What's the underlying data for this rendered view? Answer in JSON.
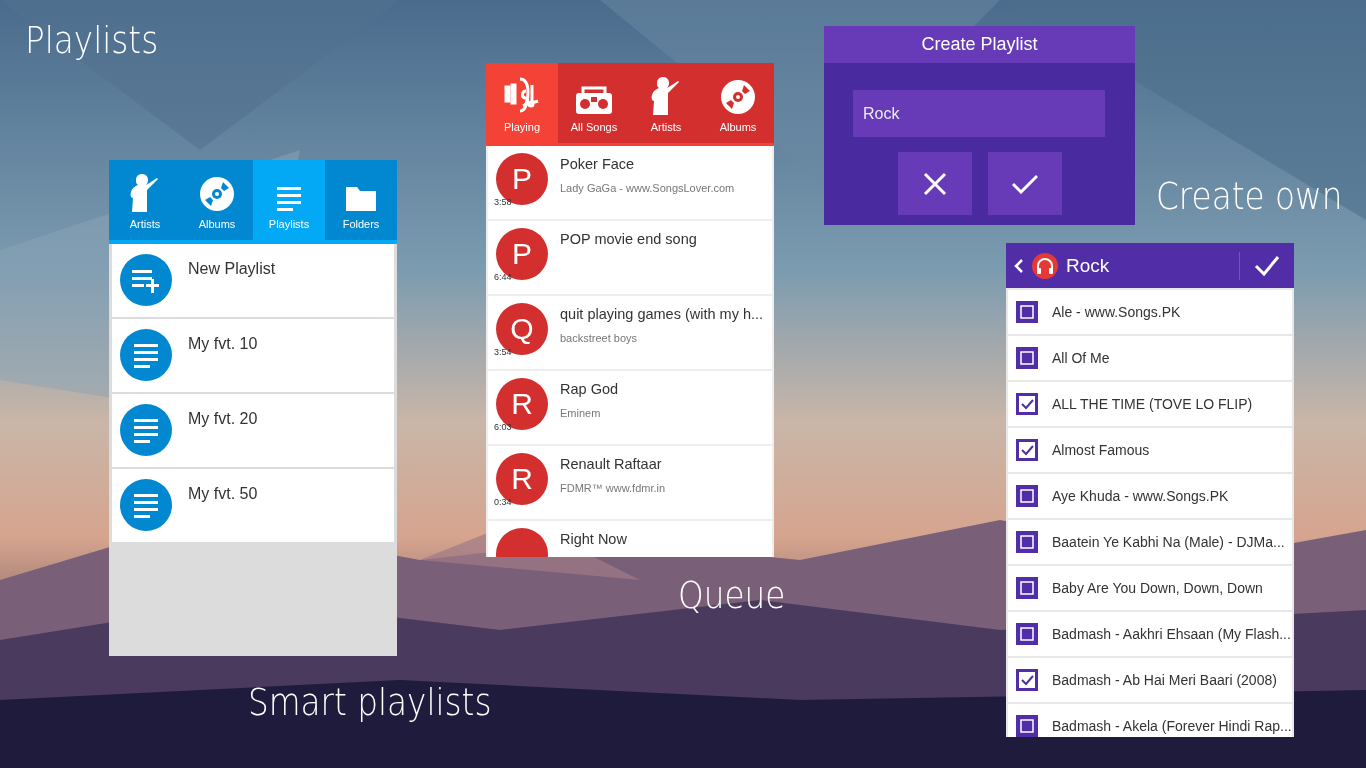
{
  "captions": [
    {
      "text": "Playlists"
    },
    {
      "text": "Smart playlists"
    },
    {
      "text": "Queue"
    },
    {
      "text": "Create own"
    }
  ],
  "library": {
    "tabs": [
      {
        "label": "Artists",
        "selected": false
      },
      {
        "label": "Albums",
        "selected": false
      },
      {
        "label": "Playlists",
        "selected": true
      },
      {
        "label": "Folders",
        "selected": false
      }
    ],
    "items": [
      {
        "kind": "new",
        "title": "New Playlist"
      },
      {
        "kind": "playlist",
        "title": "My fvt. 10"
      },
      {
        "kind": "playlist",
        "title": "My fvt. 20"
      },
      {
        "kind": "playlist",
        "title": "My fvt. 50"
      }
    ]
  },
  "queue": {
    "tabs": [
      {
        "label": "Playing",
        "selected": true
      },
      {
        "label": "All Songs",
        "selected": false
      },
      {
        "label": "Artists",
        "selected": false
      },
      {
        "label": "Albums",
        "selected": false
      }
    ],
    "songs": [
      {
        "letter": "P",
        "title": "Poker Face",
        "subtitle": "Lady GaGa - www.SongsLover.com",
        "duration": "3:58"
      },
      {
        "letter": "P",
        "title": "POP movie end song",
        "duration": "6:44"
      },
      {
        "letter": "Q",
        "title": "quit playing games (with my h...",
        "subtitle": "backstreet boys",
        "duration": "3:54"
      },
      {
        "letter": "R",
        "title": "Rap God",
        "subtitle": "Eminem",
        "duration": "6:03"
      },
      {
        "letter": "R",
        "title": "Renault Raftaar",
        "subtitle": "FDMR™ www.fdmr.in",
        "duration": "0:34"
      },
      {
        "title": "Right Now"
      }
    ]
  },
  "dialog": {
    "title": "Create Playlist",
    "field": {
      "value": "Rock"
    }
  },
  "picker": {
    "title": "Rock",
    "songs": [
      {
        "title": "Ale - www.Songs.PK",
        "checked": false
      },
      {
        "title": "All Of Me",
        "checked": false
      },
      {
        "title": "ALL THE TIME (TOVE LO FLIP)",
        "checked": true
      },
      {
        "title": "Almost Famous",
        "checked": true
      },
      {
        "title": "Aye Khuda - www.Songs.PK",
        "checked": false
      },
      {
        "title": "Baatein Ye Kabhi Na (Male) - DJMa...",
        "checked": false
      },
      {
        "title": "Baby Are You Down, Down, Down",
        "checked": false
      },
      {
        "title": "Badmash - Aakhri Ehsaan (My Flash...",
        "checked": false
      },
      {
        "title": "Badmash - Ab Hai Meri Baari (2008)",
        "checked": true
      },
      {
        "title": "Badmash - Akela (Forever Hindi Rap...",
        "checked": false
      }
    ]
  }
}
